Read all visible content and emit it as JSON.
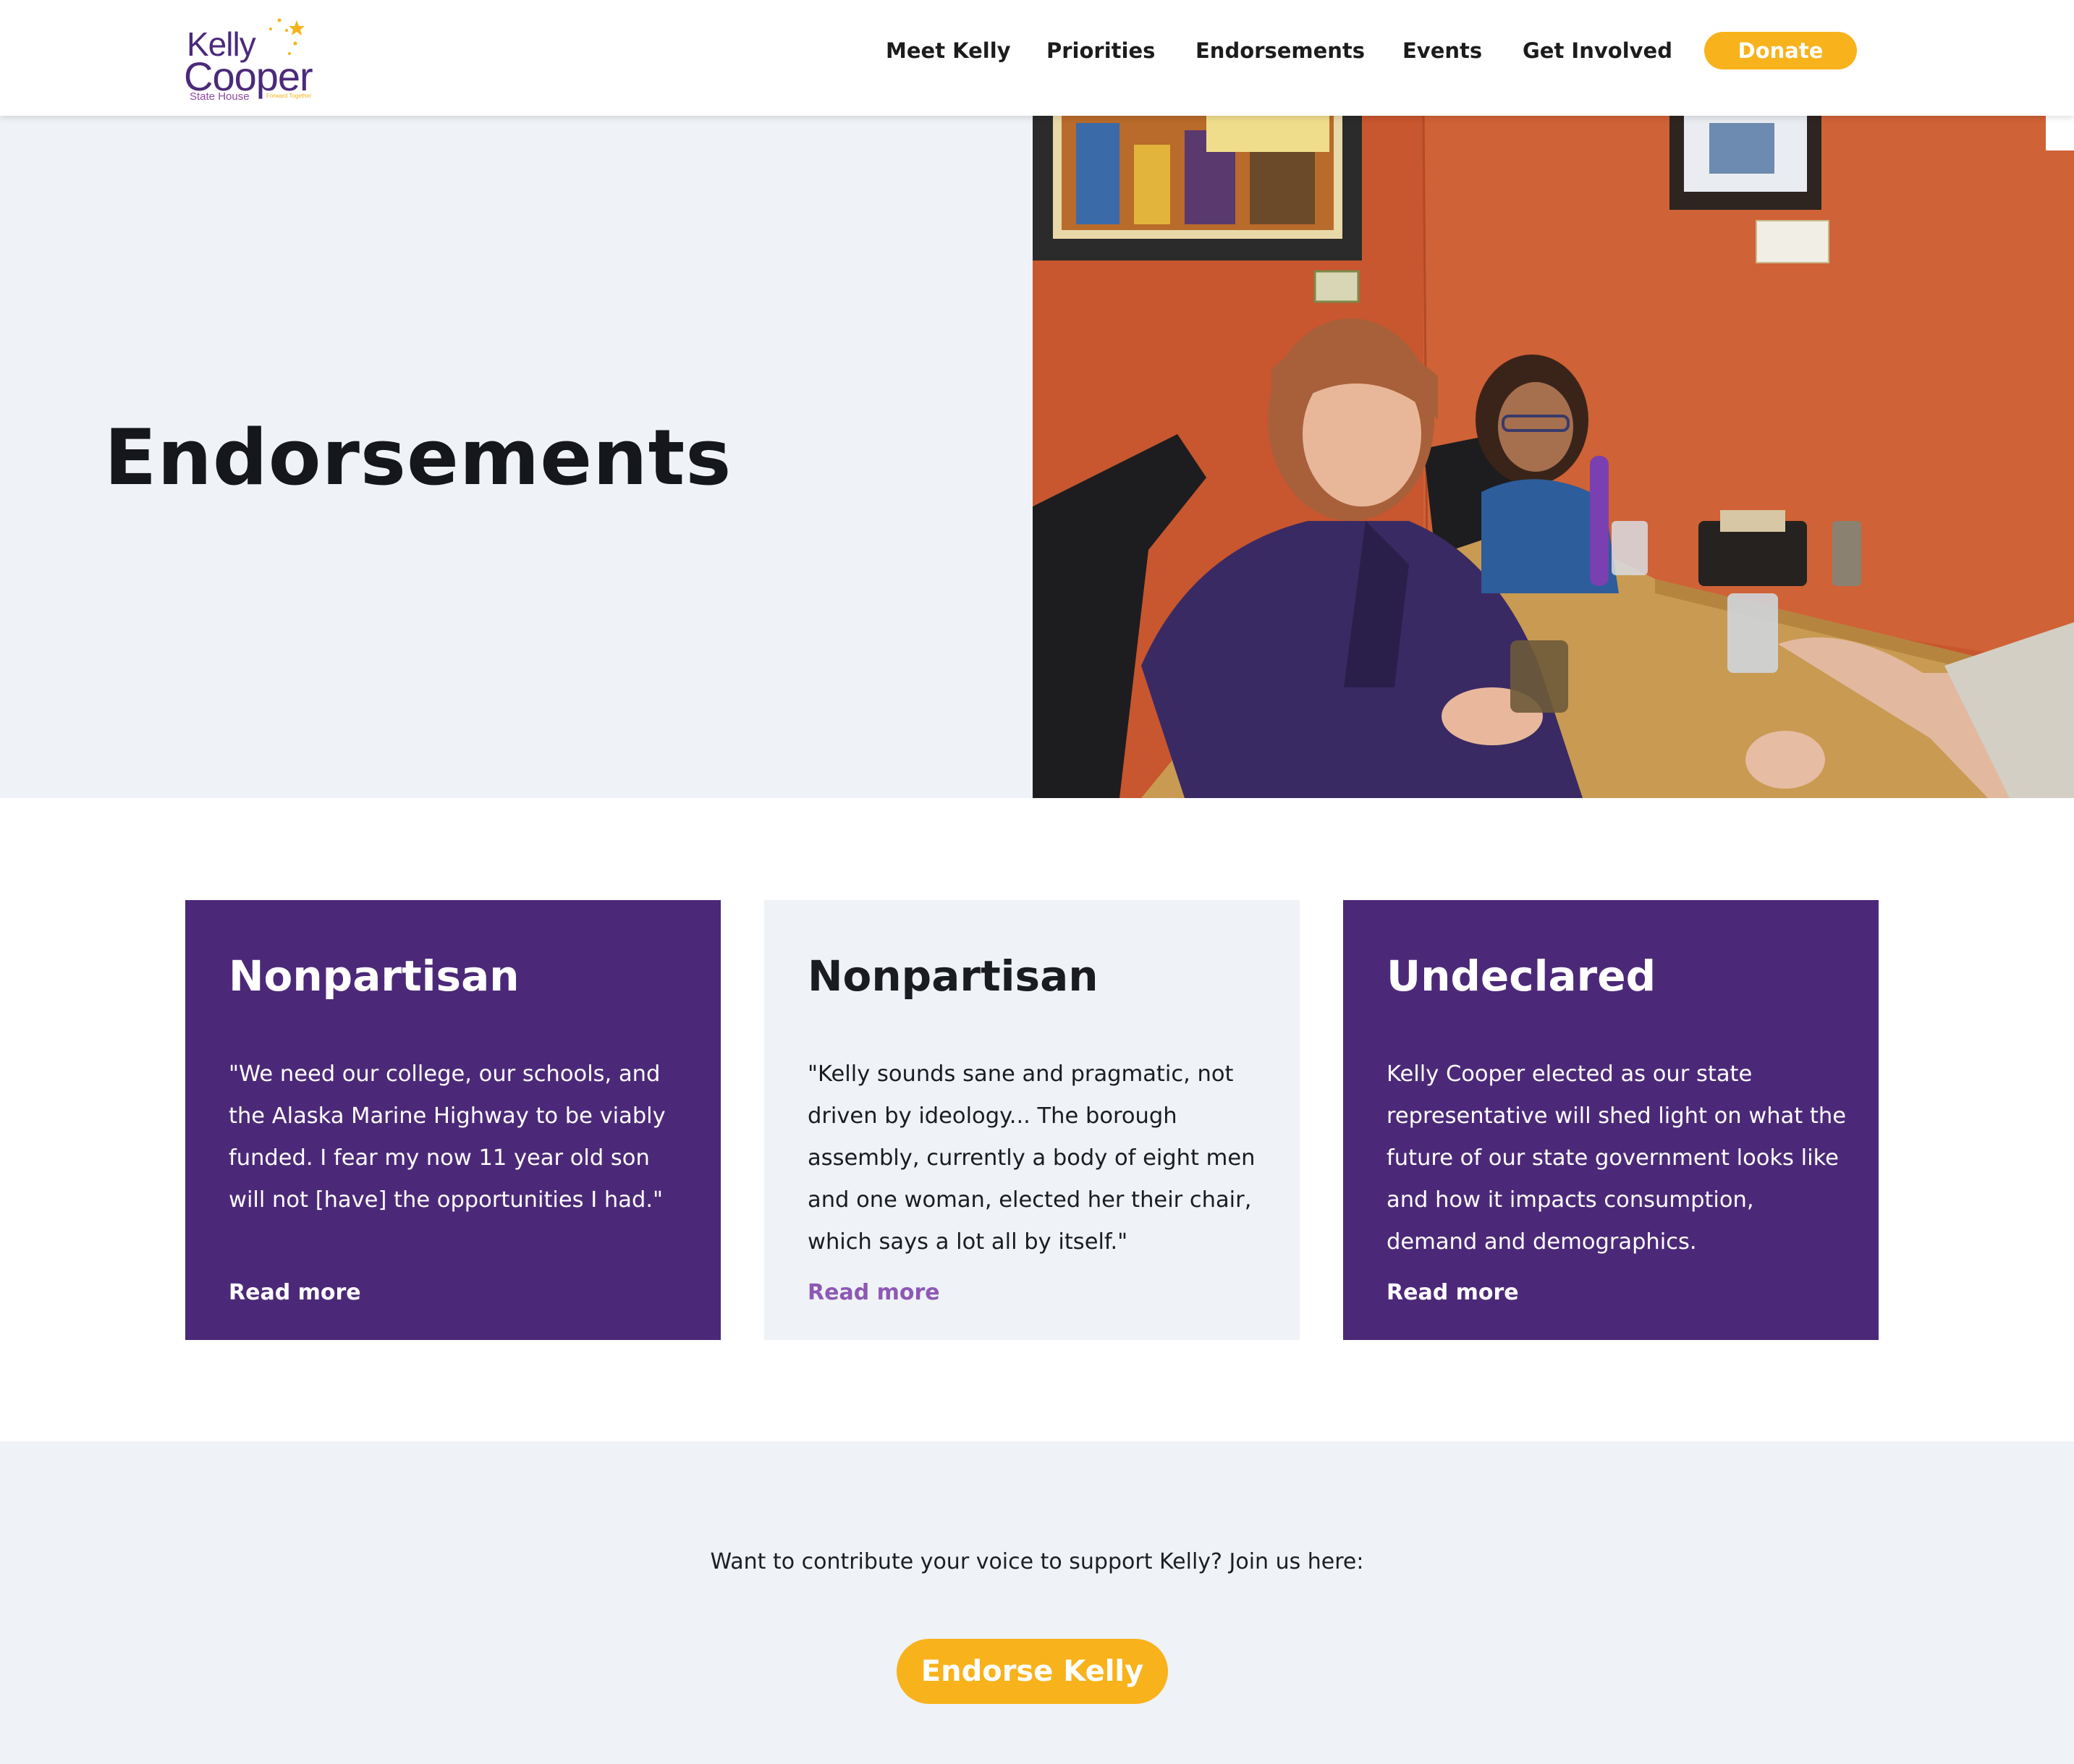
{
  "header": {
    "logo": {
      "line1": "Kelly",
      "line2": "Cooper",
      "subtitle": "State House",
      "tagline": "Forward Together"
    },
    "nav": [
      {
        "label": "Meet Kelly"
      },
      {
        "label": "Priorities"
      },
      {
        "label": "Endorsements"
      },
      {
        "label": "Events"
      },
      {
        "label": "Get Involved"
      }
    ],
    "donate_label": "Donate"
  },
  "hero": {
    "title": "Endorsements",
    "photo_icon": "hero-photo",
    "colors": {
      "wall": "#c8562e",
      "table": "#c99a52",
      "jacket": "#3a2a63"
    }
  },
  "cards": [
    {
      "title": "Nonpartisan",
      "text": "\"We need our college, our schools, and the Alaska Marine Highway to be viably funded. I fear my now 11 year old son will not [have] the opportunities I had.\"",
      "link": "Read more",
      "style": "purple"
    },
    {
      "title": "Nonpartisan",
      "text": "\"Kelly sounds sane and pragmatic, not driven by ideology... The borough assembly, currently a body of eight men and one woman, elected her their chair, which says a lot all by itself.\"",
      "link": "Read more",
      "style": "light"
    },
    {
      "title": "Undeclared",
      "text": "Kelly Cooper elected as our state representative will shed light on what the future of our state government looks like and how it impacts consumption, demand and demographics.",
      "link": "Read more",
      "style": "purple"
    }
  ],
  "cta": {
    "text": "Want to contribute your voice to support Kelly? Join us here:",
    "button_label": "Endorse Kelly"
  },
  "colors": {
    "brand_purple": "#4c2978",
    "accent_yellow": "#f8b21b",
    "link_purple": "#8d58b5",
    "panel_gray": "#eff2f6"
  }
}
